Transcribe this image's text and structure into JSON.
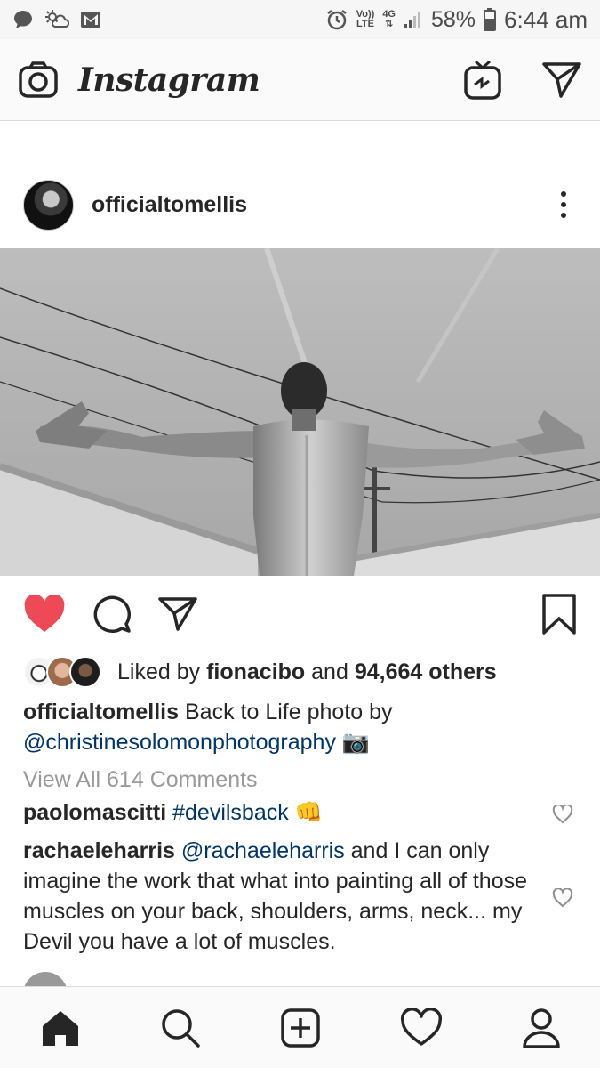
{
  "status_bar": {
    "icons_left": [
      "message-icon",
      "weather-icon",
      "gmail-icon"
    ],
    "icons_right": [
      "alarm-icon",
      "volte-icon",
      "4g-icon",
      "signal-icon",
      "battery-icon"
    ],
    "volte_line1": "Vo))",
    "volte_line2": "LTE",
    "network": "4G",
    "battery": "58%",
    "time": "6:44 am"
  },
  "header": {
    "brand": "Instagram",
    "icons": [
      "camera-icon",
      "igtv-icon",
      "direct-message-icon"
    ]
  },
  "post": {
    "username": "officialtomellis",
    "image_alt": "Black and white photo of a man from behind with arms outstretched under power lines",
    "liked_label": true,
    "likes_prefix": "Liked by",
    "likes_user": "fionacibo",
    "likes_and": "and",
    "likes_count": "94,664 others",
    "caption_user": "officialtomellis",
    "caption_text": "Back to Life  photo by",
    "caption_mention": "@christinesolomonphotography",
    "caption_emoji": "📷",
    "view_comments": "View All 614 Comments",
    "comments": [
      {
        "user": "paolomascitti",
        "hashtag": "#devilsback",
        "emoji": "👊"
      },
      {
        "user": "rachaeleharris",
        "mention": "@rachaeleharris",
        "text": "and I can only imagine the work that what into painting all of those  muscles on your back, shoulders, arms, neck... my Devil you have a lot of muscles."
      }
    ]
  },
  "nav": {
    "items": [
      "home-icon",
      "search-icon",
      "add-post-icon",
      "activity-icon",
      "profile-icon"
    ]
  },
  "colors": {
    "like_red": "#ed4956",
    "link_blue": "#003569",
    "text": "#262626",
    "muted": "#999999"
  }
}
